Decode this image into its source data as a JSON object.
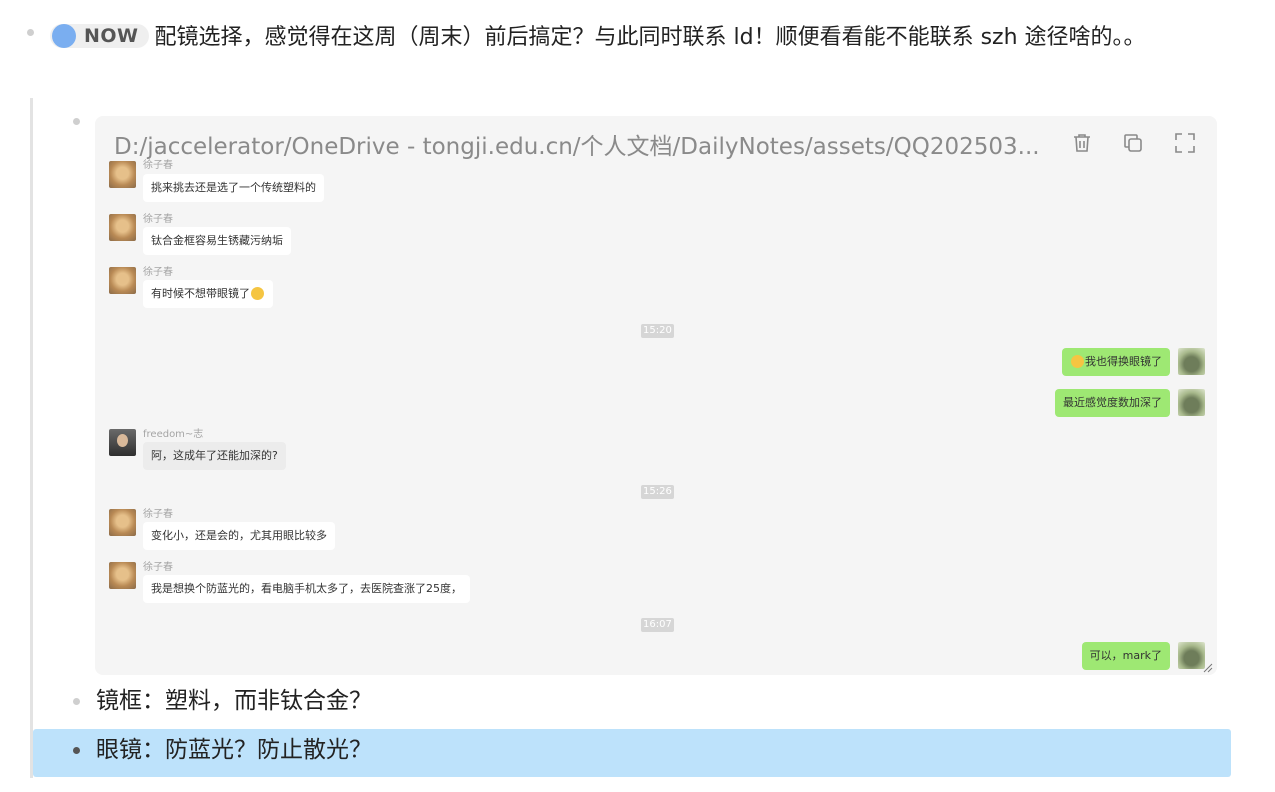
{
  "top_item": {
    "badge": "NOW",
    "text": "配镜选择，感觉得在这周（周末）前后搞定？与此同时联系 ld！顺便看看能不能联系 szh 途径啥的。。"
  },
  "image_block": {
    "path": "D:/jaccelerator/OneDrive - tongji.edu.cn/个人文档/DailyNotes/assets/QQ202503...",
    "toolbar": {
      "delete_icon": "trash-icon",
      "copy_icon": "copy-icon",
      "fullscreen_icon": "fullscreen-icon"
    }
  },
  "chat": {
    "messages": [
      {
        "sender": "徐子春",
        "text": "挑来挑去还是选了一个传统塑料的"
      },
      {
        "sender": "徐子春",
        "text": "钛合金框容易生锈藏污纳垢"
      },
      {
        "sender": "徐子春",
        "text": "有时候不想带眼镜了"
      },
      {
        "time": "15:20"
      },
      {
        "text": "我也得换眼镜了"
      },
      {
        "text": "最近感觉度数加深了"
      },
      {
        "sender": "freedom~志",
        "text": "阿，这成年了还能加深的?"
      },
      {
        "time": "15:26"
      },
      {
        "sender": "徐子春",
        "text": "变化小，还是会的，尤其用眼比较多"
      },
      {
        "sender": "徐子春",
        "text": "我是想换个防蓝光的，看电脑手机太多了，去医院查涨了25度，"
      },
      {
        "time": "16:07"
      },
      {
        "text": "可以，mark了"
      }
    ]
  },
  "sub_items": [
    {
      "text": "镜框：塑料，而非钛合金？"
    },
    {
      "text": "眼镜：防蓝光？防止散光？"
    }
  ],
  "colors": {
    "badge_dot": "#7aaef0",
    "highlight": "#bde2fb",
    "my_bubble": "#9ee873"
  }
}
